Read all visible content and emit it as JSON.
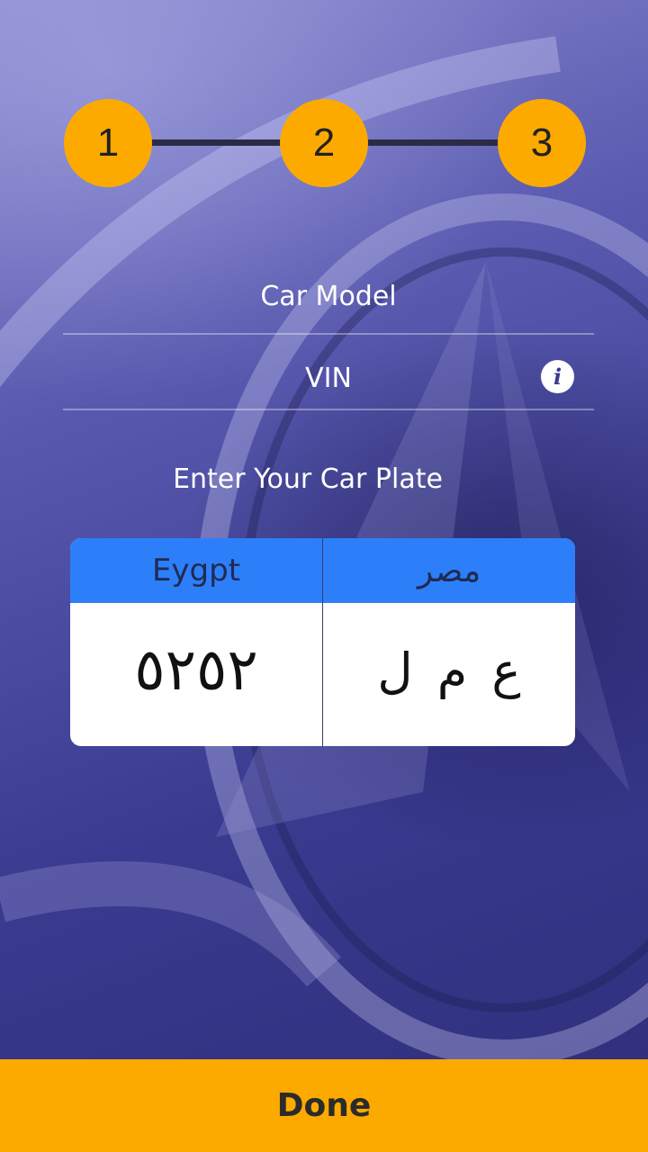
{
  "stepper": {
    "steps": [
      {
        "label": "1"
      },
      {
        "label": "2"
      },
      {
        "label": "3"
      }
    ]
  },
  "form": {
    "car_model_placeholder": "Car Model",
    "vin_placeholder": "VIN",
    "info_icon_glyph": "i"
  },
  "plate": {
    "section_title": "Enter Your Car Plate",
    "country_en": "Eygpt",
    "country_ar": "مصر",
    "number": "٥٢٥٢",
    "letters": "ع م ل"
  },
  "footer": {
    "done_label": "Done"
  },
  "colors": {
    "accent": "#fdaa00",
    "plate_header": "#2d7ff9",
    "background": "#4a4aa0"
  }
}
